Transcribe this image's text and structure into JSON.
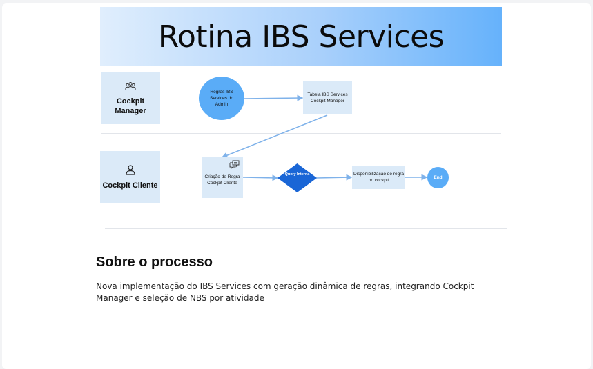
{
  "title": "Rotina IBS Services",
  "lanes": [
    {
      "label_line1": "Cockpit",
      "label_line2": "Manager",
      "icon": "people-group-icon"
    },
    {
      "label": "Cockpit Cliente",
      "icon": "user-icon"
    }
  ],
  "nodes": {
    "regras_admin": "Regras IBS Services do Admin",
    "tabela_manager": "Tabela IBS Services Cockpit Manager",
    "criacao_regra": "Criação de Regra Cockpit Cliente",
    "query_interna": "Query Interna",
    "disponibilizacao": "Disponibilização de regra no cockpit",
    "end": "End"
  },
  "colors": {
    "lane_fill": "#dbeaf8",
    "circle_fill": "#5aacf7",
    "diamond_fill": "#1a66d6",
    "edge": "#7fb2ea"
  },
  "section": {
    "title": "Sobre o processo",
    "body": "Nova implementação do IBS Services com geração dinâmica de regras, integrando Cockpit Manager e seleção de NBS por atividade"
  }
}
